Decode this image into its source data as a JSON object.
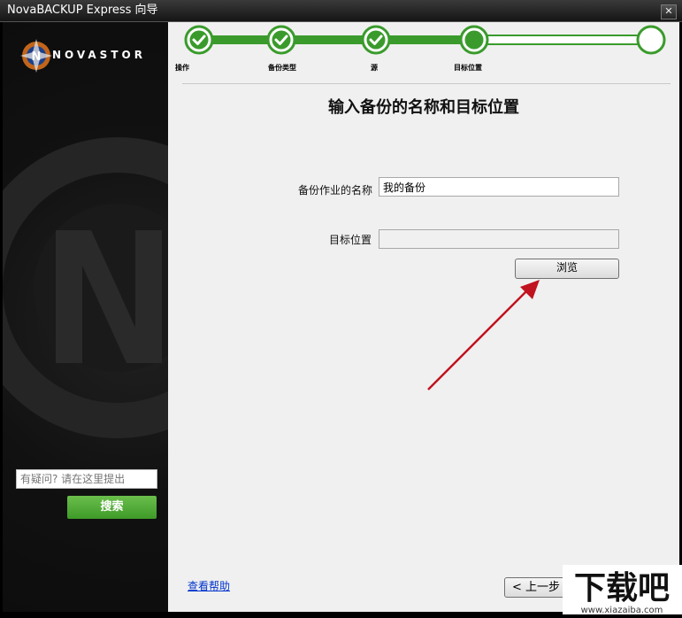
{
  "window": {
    "title": "NovaBACKUP Express 向导",
    "close_label": "✕"
  },
  "brand": {
    "logo_text": "NOVASTOR",
    "logo_glyph": "N"
  },
  "wizard": {
    "steps": [
      {
        "label": "操作",
        "status": "done"
      },
      {
        "label": "备份类型",
        "status": "done"
      },
      {
        "label": "源",
        "status": "done"
      },
      {
        "label": "目标位置",
        "status": "current"
      },
      {
        "label": "",
        "status": "pending"
      }
    ],
    "accent_color": "#3a9b2c"
  },
  "page": {
    "heading": "输入备份的名称和目标位置"
  },
  "form": {
    "job_name_label": "备份作业的名称",
    "job_name_value": "我的备份",
    "destination_label": "目标位置",
    "destination_value": "",
    "browse_label": "浏览"
  },
  "sidebar": {
    "search_placeholder": "有疑问? 请在这里提出",
    "search_button": "搜索"
  },
  "footer": {
    "help_link": "查看帮助",
    "back_button": "< 上一步"
  },
  "watermark": {
    "text": "下载吧",
    "url": "www.xiazaiba.com"
  }
}
